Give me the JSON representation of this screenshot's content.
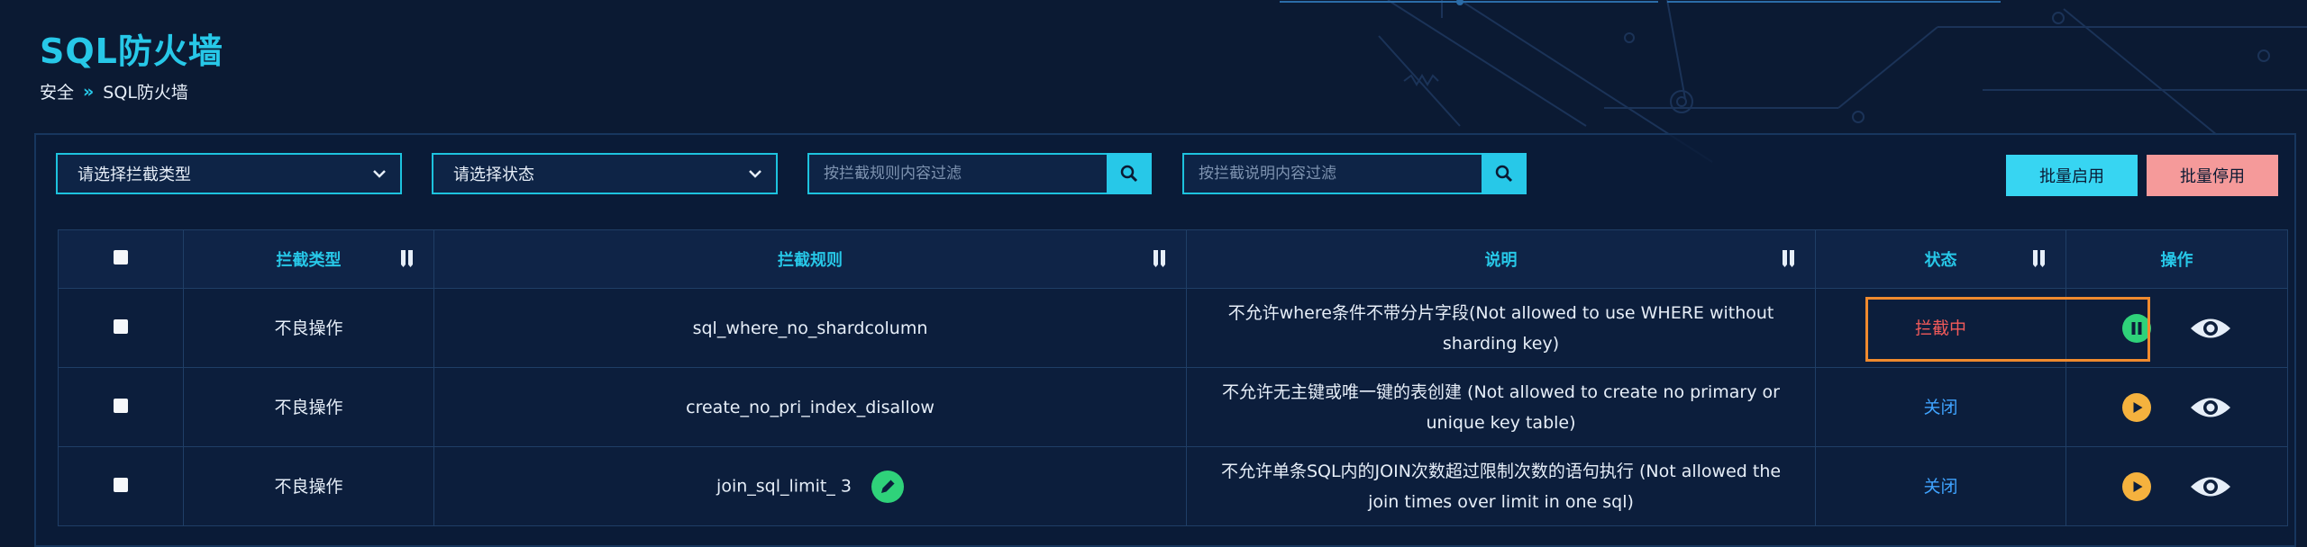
{
  "header": {
    "title": "SQL防火墙"
  },
  "breadcrumb": {
    "parent": "安全",
    "separator": "»",
    "current": "SQL防火墙"
  },
  "filters": {
    "type_select": "请选择拦截类型",
    "status_select": "请选择状态",
    "rule_search_placeholder": "按拦截规则内容过滤",
    "desc_search_placeholder": "按拦截说明内容过滤"
  },
  "actions": {
    "batch_enable": "批量启用",
    "batch_disable": "批量停用"
  },
  "table": {
    "headers": {
      "type": "拦截类型",
      "rule": "拦截规则",
      "desc": "说明",
      "status": "状态",
      "op": "操作"
    },
    "rows": [
      {
        "type": "不良操作",
        "rule": "sql_where_no_shardcolumn",
        "desc": "不允许where条件不带分片字段(Not allowed to use WHERE without sharding key)",
        "status": "拦截中",
        "status_kind": "active",
        "toggle_icon": "pause-icon",
        "editable": false
      },
      {
        "type": "不良操作",
        "rule": "create_no_pri_index_disallow",
        "desc": "不允许无主键或唯一键的表创建 (Not allowed to create no primary or unique key table)",
        "status": "关闭",
        "status_kind": "off",
        "toggle_icon": "play-icon",
        "editable": false
      },
      {
        "type": "不良操作",
        "rule": "join_sql_limit_ 3",
        "desc": "不允许单条SQL内的JOIN次数超过限制次数的语句执行 (Not allowed the join times over limit in one sql)",
        "status": "关闭",
        "status_kind": "off",
        "toggle_icon": "play-icon",
        "editable": true
      }
    ]
  },
  "colors": {
    "accent": "#27c8e8",
    "active": "#f25a5a",
    "off": "#3fa3ff",
    "pause": "#2fd27a",
    "play": "#f5b23e",
    "highlight": "#f08a2e"
  }
}
